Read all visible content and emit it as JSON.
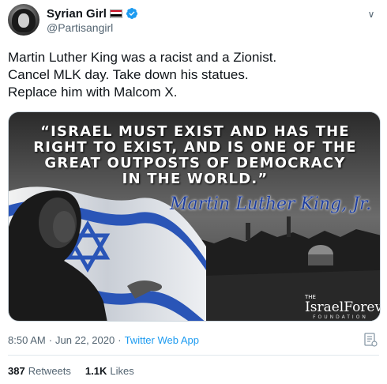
{
  "user": {
    "display_name": "Syrian Girl",
    "handle": "@Partisangirl",
    "flag": "syria-flag-icon",
    "verified_icon": "verified-badge-icon"
  },
  "tweet": {
    "lines": [
      "Martin Luther King was a racist and a Zionist.",
      "Cancel MLK day. Take down his statues.",
      "Replace him with Malcom X."
    ]
  },
  "media": {
    "quote_lines": [
      "“Israel must exist and has the",
      "right to exist, and is one of the",
      "great outposts of democracy",
      "in the world.”"
    ],
    "signature": "Martin Luther King, Jr.",
    "brand_prefix": "THE",
    "brand_name": "IsraelForever",
    "brand_sub": "FOUNDATION"
  },
  "meta": {
    "time": "8:50 AM",
    "separator1": "·",
    "date": "Jun 22, 2020",
    "separator2": "·",
    "source": "Twitter Web App"
  },
  "stats": {
    "retweets_count": "387",
    "retweets_label": "Retweets",
    "likes_count": "1.1K",
    "likes_label": "Likes"
  },
  "colors": {
    "accent": "#1d9bf0",
    "secondary_text": "#536471",
    "signature_blue": "#1f3fa0"
  }
}
